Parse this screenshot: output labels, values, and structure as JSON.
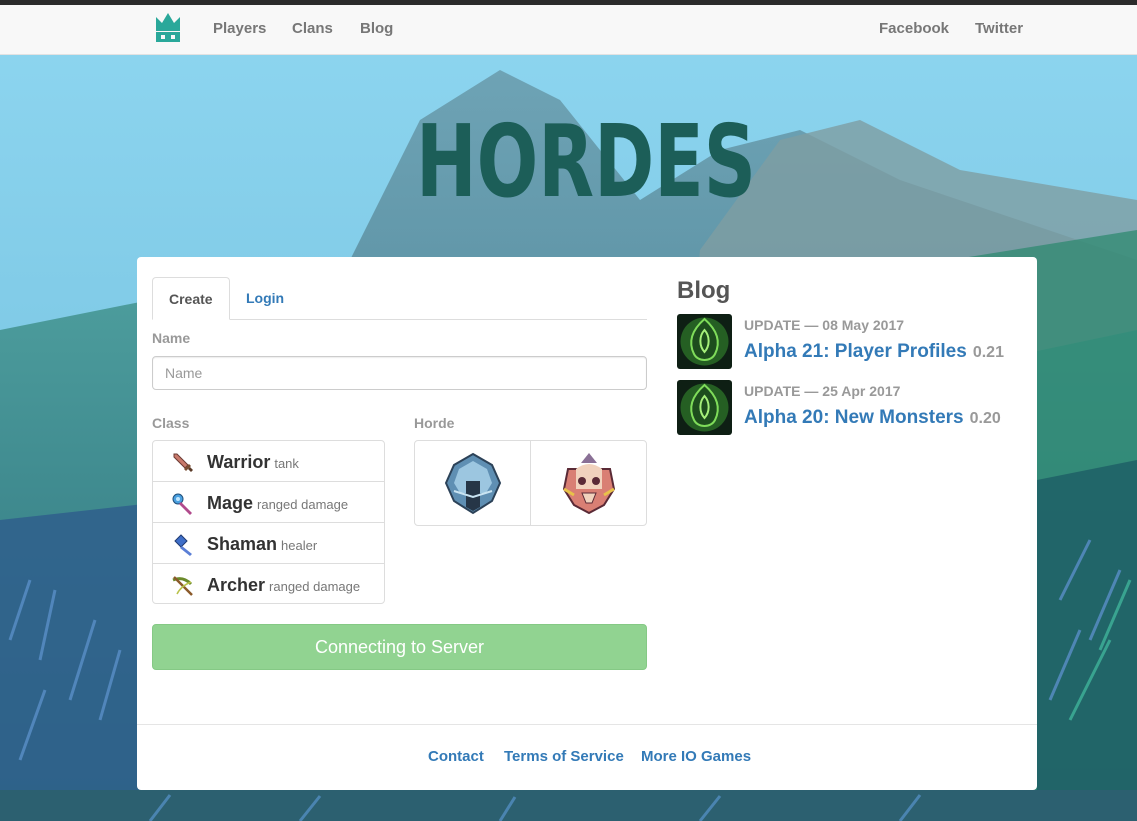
{
  "nav": {
    "logo_icon": "crown-icon",
    "links": [
      "Players",
      "Clans",
      "Blog"
    ],
    "social": [
      "Facebook",
      "Twitter"
    ]
  },
  "title": "HORDES",
  "form": {
    "tabs": {
      "create": "Create",
      "login": "Login"
    },
    "name_label": "Name",
    "name_placeholder": "Name",
    "class_label": "Class",
    "horde_label": "Horde",
    "classes": [
      {
        "name": "Warrior",
        "role": "tank",
        "icon": "sword-icon"
      },
      {
        "name": "Mage",
        "role": "ranged damage",
        "icon": "staff-icon"
      },
      {
        "name": "Shaman",
        "role": "healer",
        "icon": "hammer-icon"
      },
      {
        "name": "Archer",
        "role": "ranged damage",
        "icon": "crossbow-icon"
      }
    ],
    "hordes": [
      {
        "icon": "blue-helmet-icon"
      },
      {
        "icon": "red-skull-icon"
      }
    ],
    "connect_label": "Connecting to Server"
  },
  "blog": {
    "title": "Blog",
    "posts": [
      {
        "meta": "UPDATE — 08 May 2017",
        "title": "Alpha 21: Player Profiles",
        "version": "0.21",
        "icon": "green-leaf-icon"
      },
      {
        "meta": "UPDATE — 25 Apr 2017",
        "title": "Alpha 20: New Monsters",
        "version": "0.20",
        "icon": "green-leaf-icon"
      }
    ]
  },
  "footer": {
    "links": [
      "Contact",
      "Terms of Service",
      "More IO Games"
    ]
  },
  "colors": {
    "accent": "#337ab7",
    "title": "#1c5e58",
    "button": "#91d391",
    "logo": "#2aa89a"
  }
}
